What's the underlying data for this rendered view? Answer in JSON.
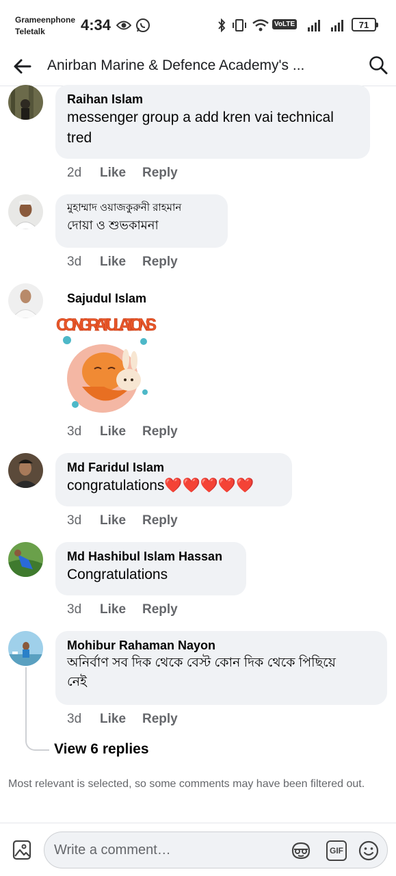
{
  "status_bar": {
    "carrier_1": "Grameenphone",
    "carrier_2": "Teletalk",
    "time": "4:34",
    "volte": "VoLTE",
    "battery": "71"
  },
  "header": {
    "title": "Anirban Marine & Defence Academy's ..."
  },
  "comments": [
    {
      "name": "Raihan Islam",
      "text_line_1": "messenger group a add kren vai technical",
      "text_line_2": "tred",
      "time": "2d",
      "like": "Like",
      "reply": "Reply"
    },
    {
      "name": "মুহাম্মাদ ওয়াজকুরুনী রাহমান",
      "text": "দোয়া ও শুভকামনা",
      "time": "3d",
      "like": "Like",
      "reply": "Reply"
    },
    {
      "name": "Sajudul Islam",
      "sticker_text": "CONGRATULATIONS",
      "time": "3d",
      "like": "Like",
      "reply": "Reply"
    },
    {
      "name": "Md Faridul Islam",
      "text": "congratulations❤️❤️❤️❤️❤️",
      "time": "3d",
      "like": "Like",
      "reply": "Reply"
    },
    {
      "name": "Md Hashibul Islam Hassan",
      "text": "Congratulations",
      "time": "3d",
      "like": "Like",
      "reply": "Reply"
    },
    {
      "name": "Mohibur Rahaman Nayon",
      "text_line_1": "অনির্বাণ সব দিক থেকে বেস্ট কোন দিক থেকে পিছিয়ে",
      "text_line_2": "নেই",
      "time": "3d",
      "like": "Like",
      "reply": "Reply"
    }
  ],
  "view_replies": "View 6 replies",
  "filter_note": "Most relevant is selected, so some comments may have been filtered out.",
  "composer": {
    "placeholder": "Write a comment…",
    "gif_label": "GIF"
  },
  "colors": {
    "bubble": "#f0f2f5",
    "meta_text": "#65676b",
    "heart": "#e8203a"
  }
}
